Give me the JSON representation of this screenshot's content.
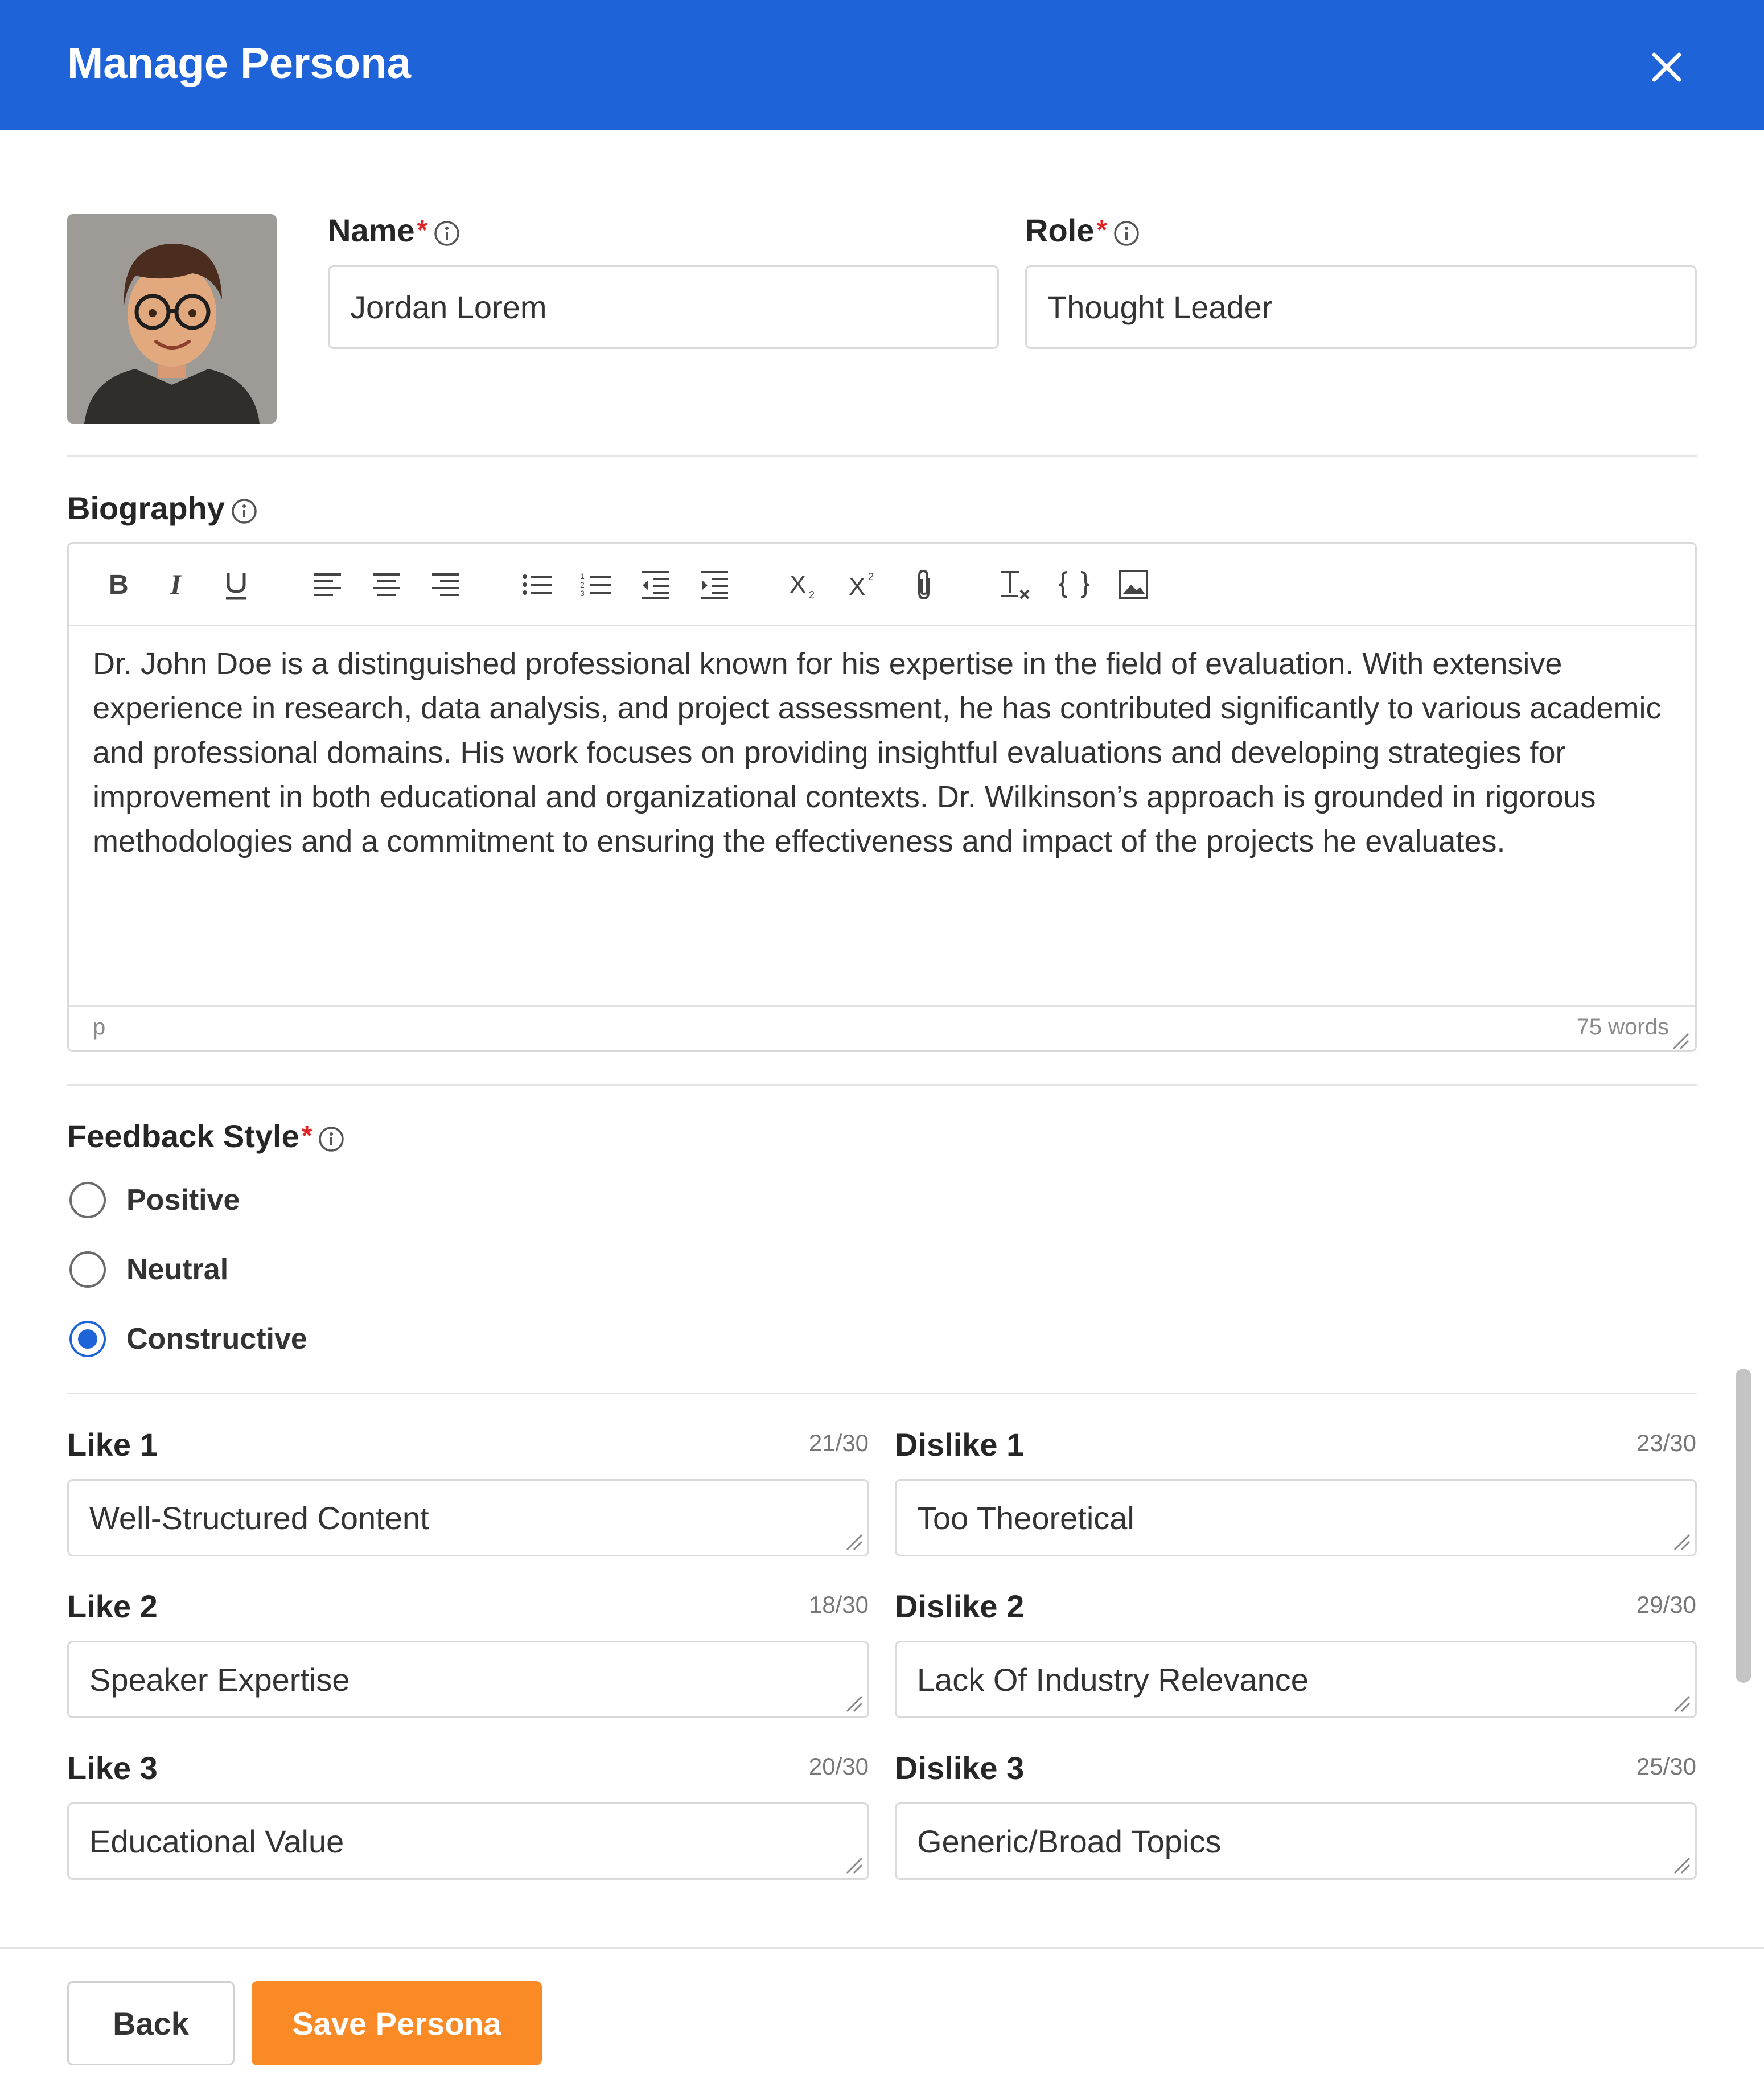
{
  "header": {
    "title": "Manage Persona",
    "close_icon": "close-icon"
  },
  "name": {
    "label": "Name",
    "required_mark": "*",
    "value": "Jordan Lorem"
  },
  "role": {
    "label": "Role",
    "required_mark": "*",
    "value": "Thought Leader"
  },
  "biography": {
    "label": "Biography",
    "toolbar": [
      "bold-icon",
      "italic-icon",
      "underline-icon",
      "align-left-icon",
      "align-center-icon",
      "align-right-icon",
      "bullet-list-icon",
      "numbered-list-icon",
      "outdent-icon",
      "indent-icon",
      "subscript-icon",
      "superscript-icon",
      "attachment-icon",
      "clear-format-icon",
      "code-icon",
      "image-icon"
    ],
    "text": "Dr. John Doe is a distinguished professional known for his expertise in the field of evaluation. With extensive experience in research, data analysis, and project assessment, he has contributed significantly to various academic and professional domains. His work focuses on providing insightful evaluations and developing strategies for improvement in both educational and organizational contexts. Dr. Wilkinson’s approach is grounded in rigorous methodologies and a commitment to ensuring the effectiveness and impact of the projects he evaluates.",
    "status_path": "p",
    "word_count": "75 words"
  },
  "feedback_style": {
    "label": "Feedback Style",
    "required_mark": "*",
    "options": [
      "Positive",
      "Neutral",
      "Constructive"
    ],
    "selected": "Constructive"
  },
  "likes": [
    {
      "label": "Like 1",
      "counter": "21/30",
      "value": "Well-Structured Content"
    },
    {
      "label": "Like 2",
      "counter": "18/30",
      "value": "Speaker Expertise"
    },
    {
      "label": "Like 3",
      "counter": "20/30",
      "value": "Educational Value"
    }
  ],
  "dislikes": [
    {
      "label": "Dislike 1",
      "counter": "23/30",
      "value": "Too Theoretical"
    },
    {
      "label": "Dislike 2",
      "counter": "29/30",
      "value": "Lack Of Industry Relevance"
    },
    {
      "label": "Dislike 3",
      "counter": "25/30",
      "value": "Generic/Broad Topics"
    }
  ],
  "footer": {
    "back_label": "Back",
    "save_label": "Save Persona"
  },
  "colors": {
    "primary": "#1f63d8",
    "save": "#fa8a26",
    "required": "#e02424"
  }
}
